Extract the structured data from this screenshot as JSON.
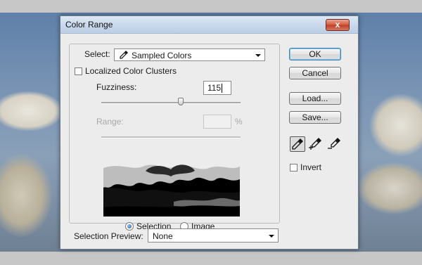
{
  "window": {
    "title": "Color Range",
    "close_label": "x"
  },
  "select": {
    "label": "Select:",
    "value": "Sampled Colors"
  },
  "localized": {
    "label": "Localized Color Clusters",
    "checked": false
  },
  "fuzziness": {
    "label": "Fuzziness:",
    "value": "115",
    "slider_fraction": 0.57
  },
  "range": {
    "label": "Range:",
    "value": "",
    "unit": "%"
  },
  "view": {
    "selection_label": "Selection",
    "image_label": "Image",
    "selected": "Selection"
  },
  "preview_mode": {
    "label": "Selection Preview:",
    "value": "None"
  },
  "buttons": {
    "ok": "OK",
    "cancel": "Cancel",
    "load": "Load...",
    "save": "Save..."
  },
  "invert": {
    "label": "Invert",
    "checked": false
  },
  "tools": [
    "eyedropper-icon",
    "eyedropper-plus-icon",
    "eyedropper-minus-icon"
  ]
}
